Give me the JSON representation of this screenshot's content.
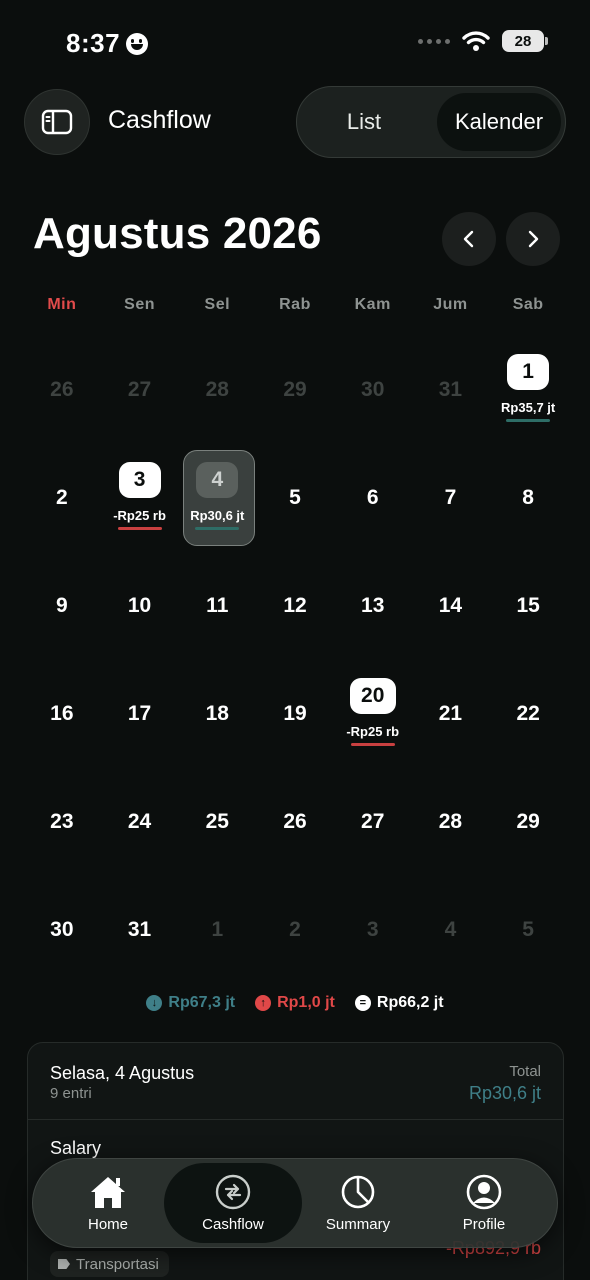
{
  "status_bar": {
    "time": "8:37",
    "battery": "28"
  },
  "header": {
    "title": "Cashflow",
    "segments": {
      "list": "List",
      "calendar": "Kalender"
    }
  },
  "month": {
    "title": "Agustus 2026"
  },
  "weekdays": [
    "Min",
    "Sen",
    "Sel",
    "Rab",
    "Kam",
    "Jum",
    "Sab"
  ],
  "calendar": {
    "days": [
      {
        "n": "26",
        "muted": true
      },
      {
        "n": "27",
        "muted": true
      },
      {
        "n": "28",
        "muted": true
      },
      {
        "n": "29",
        "muted": true
      },
      {
        "n": "30",
        "muted": true
      },
      {
        "n": "31",
        "muted": true
      },
      {
        "n": "1",
        "amount": "Rp35,7 jt",
        "kind": "income"
      },
      {
        "n": "2"
      },
      {
        "n": "3",
        "amount": "-Rp25 rb",
        "kind": "expense"
      },
      {
        "n": "4",
        "amount": "Rp30,6 jt",
        "kind": "income",
        "selected": true
      },
      {
        "n": "5"
      },
      {
        "n": "6"
      },
      {
        "n": "7"
      },
      {
        "n": "8"
      },
      {
        "n": "9"
      },
      {
        "n": "10"
      },
      {
        "n": "11"
      },
      {
        "n": "12"
      },
      {
        "n": "13"
      },
      {
        "n": "14"
      },
      {
        "n": "15"
      },
      {
        "n": "16"
      },
      {
        "n": "17"
      },
      {
        "n": "18"
      },
      {
        "n": "19"
      },
      {
        "n": "20",
        "amount": "-Rp25 rb",
        "kind": "expense"
      },
      {
        "n": "21"
      },
      {
        "n": "22"
      },
      {
        "n": "23"
      },
      {
        "n": "24"
      },
      {
        "n": "25"
      },
      {
        "n": "26"
      },
      {
        "n": "27"
      },
      {
        "n": "28"
      },
      {
        "n": "29"
      },
      {
        "n": "30"
      },
      {
        "n": "31"
      },
      {
        "n": "1",
        "muted": true
      },
      {
        "n": "2",
        "muted": true
      },
      {
        "n": "3",
        "muted": true
      },
      {
        "n": "4",
        "muted": true
      },
      {
        "n": "5",
        "muted": true
      }
    ]
  },
  "totals": {
    "income": "Rp67,3 jt",
    "expense": "Rp1,0 jt",
    "net": "Rp66,2 jt"
  },
  "day_card": {
    "date": "Selasa, 4 Agustus",
    "entries": "9 entri",
    "total_label": "Total",
    "total_value": "Rp30,6 jt",
    "row_title": "Salary",
    "tag": "Transportasi",
    "row_amount": "-Rp892,9 rb"
  },
  "bottom_nav": {
    "home": "Home",
    "cashflow": "Cashflow",
    "summary": "Summary",
    "profile": "Profile"
  },
  "colors": {
    "income": "#3f7f88",
    "expense": "#e04848",
    "background": "#0b0e0d"
  }
}
